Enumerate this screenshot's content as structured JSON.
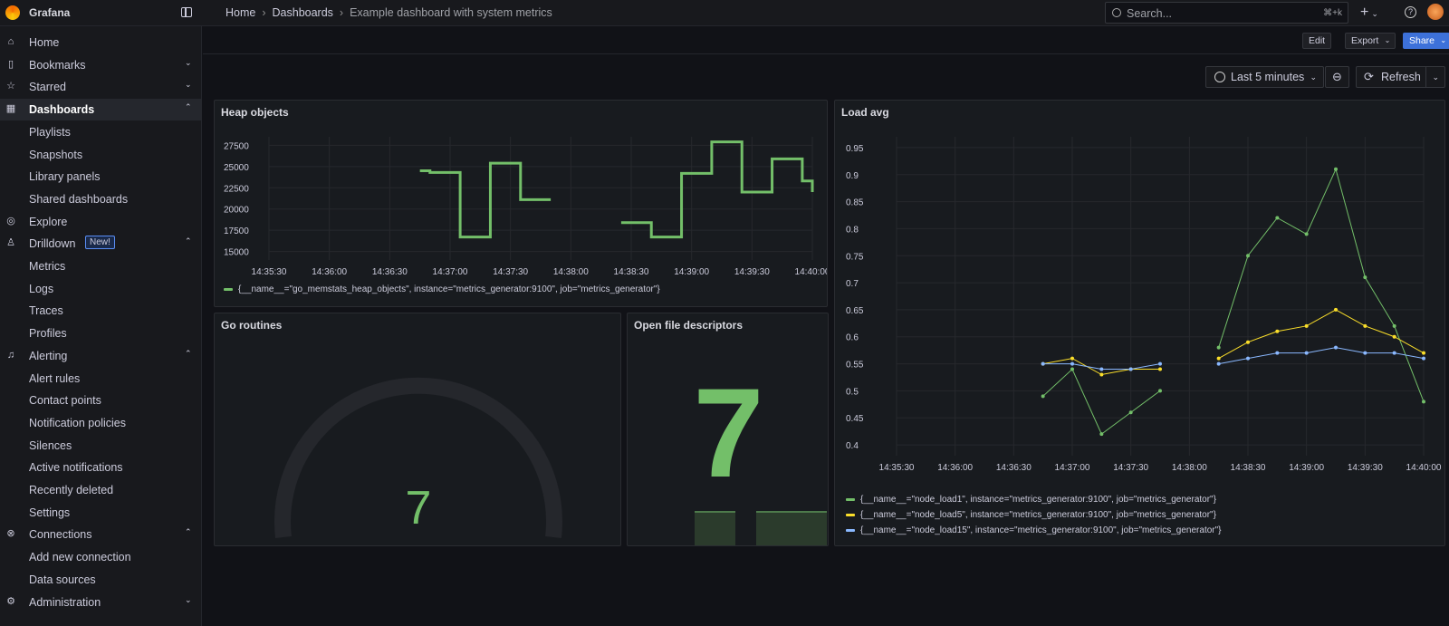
{
  "topbar": {
    "app_name": "Grafana",
    "breadcrumb": [
      "Home",
      "Dashboards",
      "Example dashboard with system metrics"
    ],
    "search_placeholder": "Search...",
    "search_shortcut": "⌘+k"
  },
  "sidebar": {
    "items": [
      {
        "label": "Home",
        "icon": "home-icon",
        "level": 0
      },
      {
        "label": "Bookmarks",
        "icon": "bookmark-icon",
        "level": 0,
        "chevron": "down"
      },
      {
        "label": "Starred",
        "icon": "star-icon",
        "level": 0,
        "chevron": "down"
      },
      {
        "label": "Dashboards",
        "icon": "dashboards-icon",
        "level": 0,
        "chevron": "up",
        "active": true
      },
      {
        "label": "Playlists",
        "level": 1
      },
      {
        "label": "Snapshots",
        "level": 1
      },
      {
        "label": "Library panels",
        "level": 1
      },
      {
        "label": "Shared dashboards",
        "level": 1
      },
      {
        "label": "Explore",
        "icon": "compass-icon",
        "level": 0
      },
      {
        "label": "Drilldown",
        "icon": "drilldown-icon",
        "level": 0,
        "chevron": "up",
        "badge": "New!"
      },
      {
        "label": "Metrics",
        "level": 1
      },
      {
        "label": "Logs",
        "level": 1
      },
      {
        "label": "Traces",
        "level": 1
      },
      {
        "label": "Profiles",
        "level": 1
      },
      {
        "label": "Alerting",
        "icon": "bell-icon",
        "level": 0,
        "chevron": "up"
      },
      {
        "label": "Alert rules",
        "level": 1
      },
      {
        "label": "Contact points",
        "level": 1
      },
      {
        "label": "Notification policies",
        "level": 1
      },
      {
        "label": "Silences",
        "level": 1
      },
      {
        "label": "Active notifications",
        "level": 1
      },
      {
        "label": "Recently deleted",
        "level": 1
      },
      {
        "label": "Settings",
        "level": 1
      },
      {
        "label": "Connections",
        "icon": "connections-icon",
        "level": 0,
        "chevron": "up"
      },
      {
        "label": "Add new connection",
        "level": 1
      },
      {
        "label": "Data sources",
        "level": 1
      },
      {
        "label": "Administration",
        "icon": "gear-icon",
        "level": 0,
        "chevron": "down"
      }
    ]
  },
  "toolbar": {
    "edit": "Edit",
    "export": "Export",
    "share": "Share",
    "time_range": "Last 5 minutes",
    "refresh": "Refresh"
  },
  "colors": {
    "green": "#73bf69",
    "yellow": "#fade2a",
    "blue": "#8ab8ff"
  },
  "panels": {
    "heap": {
      "title": "Heap objects",
      "legend": "{__name__=\"go_memstats_heap_objects\", instance=\"metrics_generator:9100\", job=\"metrics_generator\"}"
    },
    "goroutines": {
      "title": "Go routines",
      "value": "7"
    },
    "fds": {
      "title": "Open file descriptors",
      "value": "7"
    },
    "load": {
      "title": "Load avg",
      "legend": [
        "{__name__=\"node_load1\", instance=\"metrics_generator:9100\", job=\"metrics_generator\"}",
        "{__name__=\"node_load5\", instance=\"metrics_generator:9100\", job=\"metrics_generator\"}",
        "{__name__=\"node_load15\", instance=\"metrics_generator:9100\", job=\"metrics_generator\"}"
      ]
    }
  },
  "chart_data": [
    {
      "type": "line",
      "title": "Heap objects",
      "x_ticks": [
        "14:35:30",
        "14:36:00",
        "14:36:30",
        "14:37:00",
        "14:37:30",
        "14:38:00",
        "14:38:30",
        "14:39:00",
        "14:39:30",
        "14:40:00"
      ],
      "y_ticks": [
        15000,
        17500,
        20000,
        22500,
        25000,
        27500
      ],
      "ylim": [
        14000,
        28500
      ],
      "series": [
        {
          "name": "{__name__=\"go_memstats_heap_objects\", instance=\"metrics_generator:9100\", job=\"metrics_generator\"}",
          "step": true,
          "x": [
            "14:36:45",
            "14:36:50",
            "14:37:05",
            "14:37:20",
            "14:37:35",
            "14:37:50",
            "",
            "14:38:25",
            "14:38:40",
            "14:38:55",
            "14:39:10",
            "14:39:25",
            "14:39:40",
            "14:39:55",
            "14:40:00"
          ],
          "y": [
            24500,
            24300,
            16700,
            25400,
            21100,
            21100,
            null,
            18400,
            16700,
            24200,
            27900,
            22000,
            25900,
            23300,
            22000
          ]
        }
      ]
    },
    {
      "type": "line",
      "title": "Load avg",
      "x_ticks": [
        "14:35:30",
        "14:36:00",
        "14:36:30",
        "14:37:00",
        "14:37:30",
        "14:38:00",
        "14:38:30",
        "14:39:00",
        "14:39:30",
        "14:40:00"
      ],
      "y_ticks": [
        0.4,
        0.45,
        0.5,
        0.55,
        0.6,
        0.65,
        0.7,
        0.75,
        0.8,
        0.85,
        0.9,
        0.95
      ],
      "ylim": [
        0.38,
        0.97
      ],
      "x": [
        "14:36:45",
        "14:37:00",
        "14:37:15",
        "14:37:30",
        "14:37:45",
        "",
        "14:38:15",
        "14:38:30",
        "14:38:45",
        "14:39:00",
        "14:39:15",
        "14:39:30",
        "14:39:45",
        "14:40:00"
      ],
      "series": [
        {
          "name": "{__name__=\"node_load1\", instance=\"metrics_generator:9100\", job=\"metrics_generator\"}",
          "y": [
            0.49,
            0.54,
            0.42,
            0.46,
            0.5,
            null,
            0.58,
            0.75,
            0.82,
            0.79,
            0.91,
            0.71,
            0.62,
            0.48
          ]
        },
        {
          "name": "{__name__=\"node_load5\", instance=\"metrics_generator:9100\", job=\"metrics_generator\"}",
          "y": [
            0.55,
            0.56,
            0.53,
            0.54,
            0.54,
            null,
            0.56,
            0.59,
            0.61,
            0.62,
            0.65,
            0.62,
            0.6,
            0.57
          ]
        },
        {
          "name": "{__name__=\"node_load15\", instance=\"metrics_generator:9100\", job=\"metrics_generator\"}",
          "y": [
            0.55,
            0.55,
            0.54,
            0.54,
            0.55,
            null,
            0.55,
            0.56,
            0.57,
            0.57,
            0.58,
            0.57,
            0.57,
            0.56
          ]
        }
      ]
    }
  ]
}
